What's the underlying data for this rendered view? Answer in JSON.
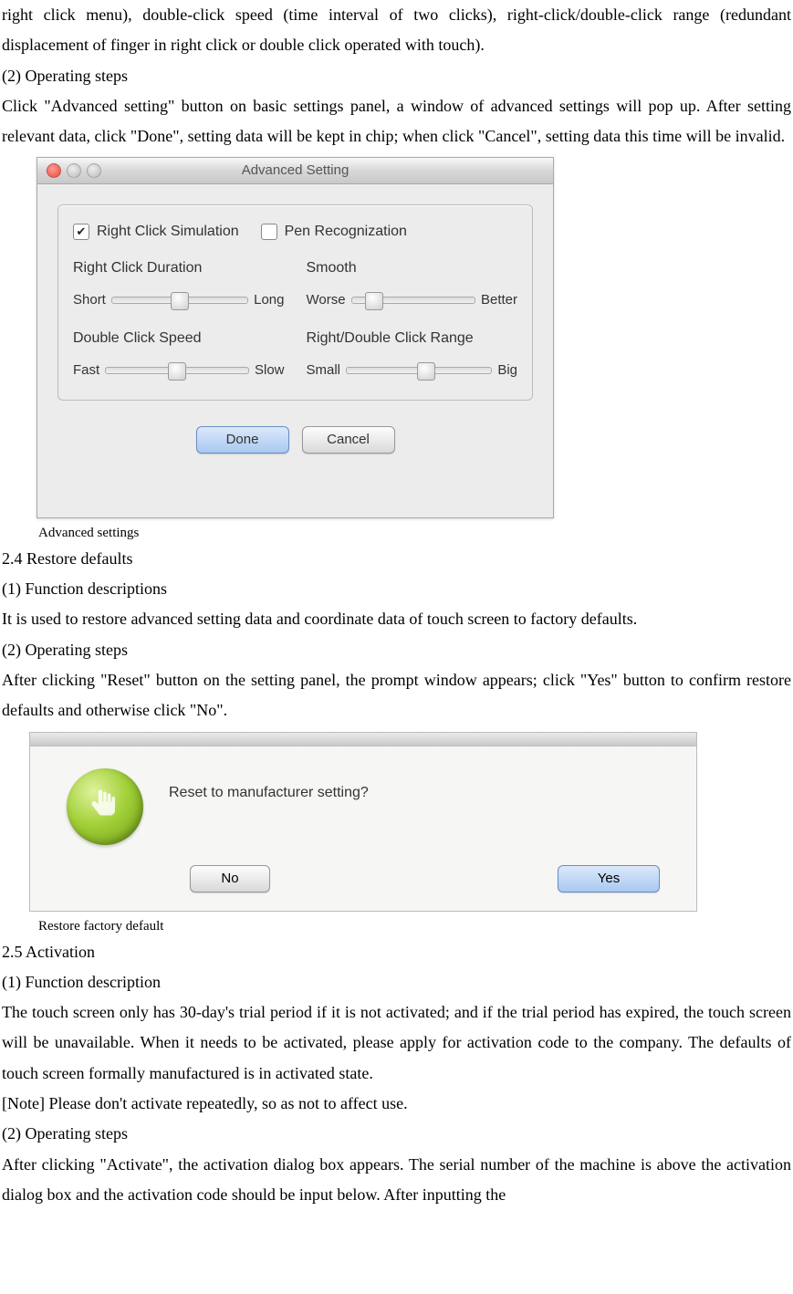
{
  "para_top": "right click menu), double-click speed (time interval of two clicks), right-click/double-click range (redundant displacement of finger in right click or double click operated with touch).",
  "ops1_head": "(2) Operating steps",
  "ops1_body": "Click \"Advanced setting\" button on basic settings panel, a window of advanced settings will pop up. After setting relevant data, click \"Done\", setting data will be kept in chip; when click \"Cancel\", setting data this time will be invalid.",
  "adv": {
    "title": "Advanced Setting",
    "chk_right": "Right Click Simulation",
    "chk_pen": "Pen Recognization",
    "right_dur_label": "Right Click Duration",
    "short": "Short",
    "long": "Long",
    "smooth_label": "Smooth",
    "worse": "Worse",
    "better": "Better",
    "dbl_label": "Double Click Speed",
    "fast": "Fast",
    "slow": "Slow",
    "range_label": "Right/Double Click Range",
    "small": "Small",
    "big": "Big",
    "done": "Done",
    "cancel": "Cancel"
  },
  "caption_adv": "Advanced settings",
  "h24": "2.4 Restore defaults",
  "func1_head": "(1) Function descriptions",
  "func1_body": "It is used to restore advanced setting data and coordinate data of touch screen to factory defaults.",
  "ops2_head": "(2) Operating steps",
  "ops2_body": "After clicking \"Reset\" button on the setting panel, the prompt window appears; click \"Yes\" button to confirm restore defaults and otherwise click \"No\".",
  "reset": {
    "msg": "Reset to manufacturer setting?",
    "no": "No",
    "yes": "Yes"
  },
  "caption_reset": "Restore factory default",
  "h25": "2.5 Activation",
  "func2_head": "(1) Function description",
  "func2_body": "The touch screen only has 30-day's trial period if it is not activated; and if the trial period has expired, the touch screen will be unavailable. When it needs to be activated, please apply for activation code to the company. The defaults of touch screen formally manufactured is in activated state.",
  "note": "[Note] Please don't activate repeatedly, so as not to affect use.",
  "ops3_head": "(2) Operating steps",
  "ops3_body": "After clicking \"Activate\", the activation dialog box appears. The serial number of the machine is above the activation dialog box and the activation code should be input below. After inputting the"
}
